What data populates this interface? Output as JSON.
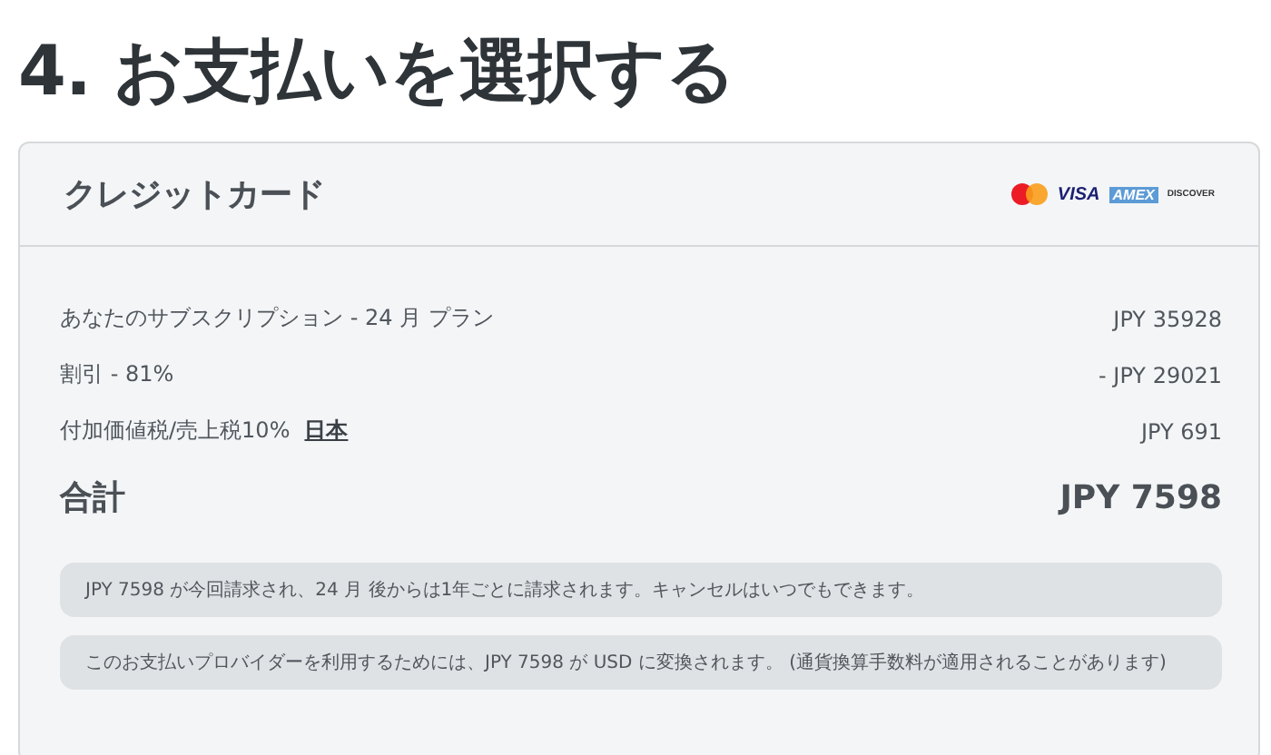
{
  "heading": "4. お支払いを選択する",
  "card": {
    "title": "クレジットカード",
    "brands": [
      "VISA",
      "AMEX",
      "DISCOVER"
    ],
    "lines": [
      {
        "label": "あなたのサブスクリプション - 24 月 プラン",
        "amount": "JPY 35928"
      },
      {
        "label": "割引 - 81%",
        "amount": "- JPY 29021"
      },
      {
        "label": "付加価値税/売上税10%",
        "link": "日本",
        "amount": "JPY 691"
      }
    ],
    "total": {
      "label": "合計",
      "amount": "JPY 7598"
    },
    "notes": [
      "JPY 7598 が今回請求され、24 月 後からは1年ごとに請求されます。キャンセルはいつでもできます。",
      "このお支払いプロバイダーを利用するためには、JPY 7598 が USD に変換されます。 (通貨換算手数料が適用されることがあります)"
    ]
  }
}
